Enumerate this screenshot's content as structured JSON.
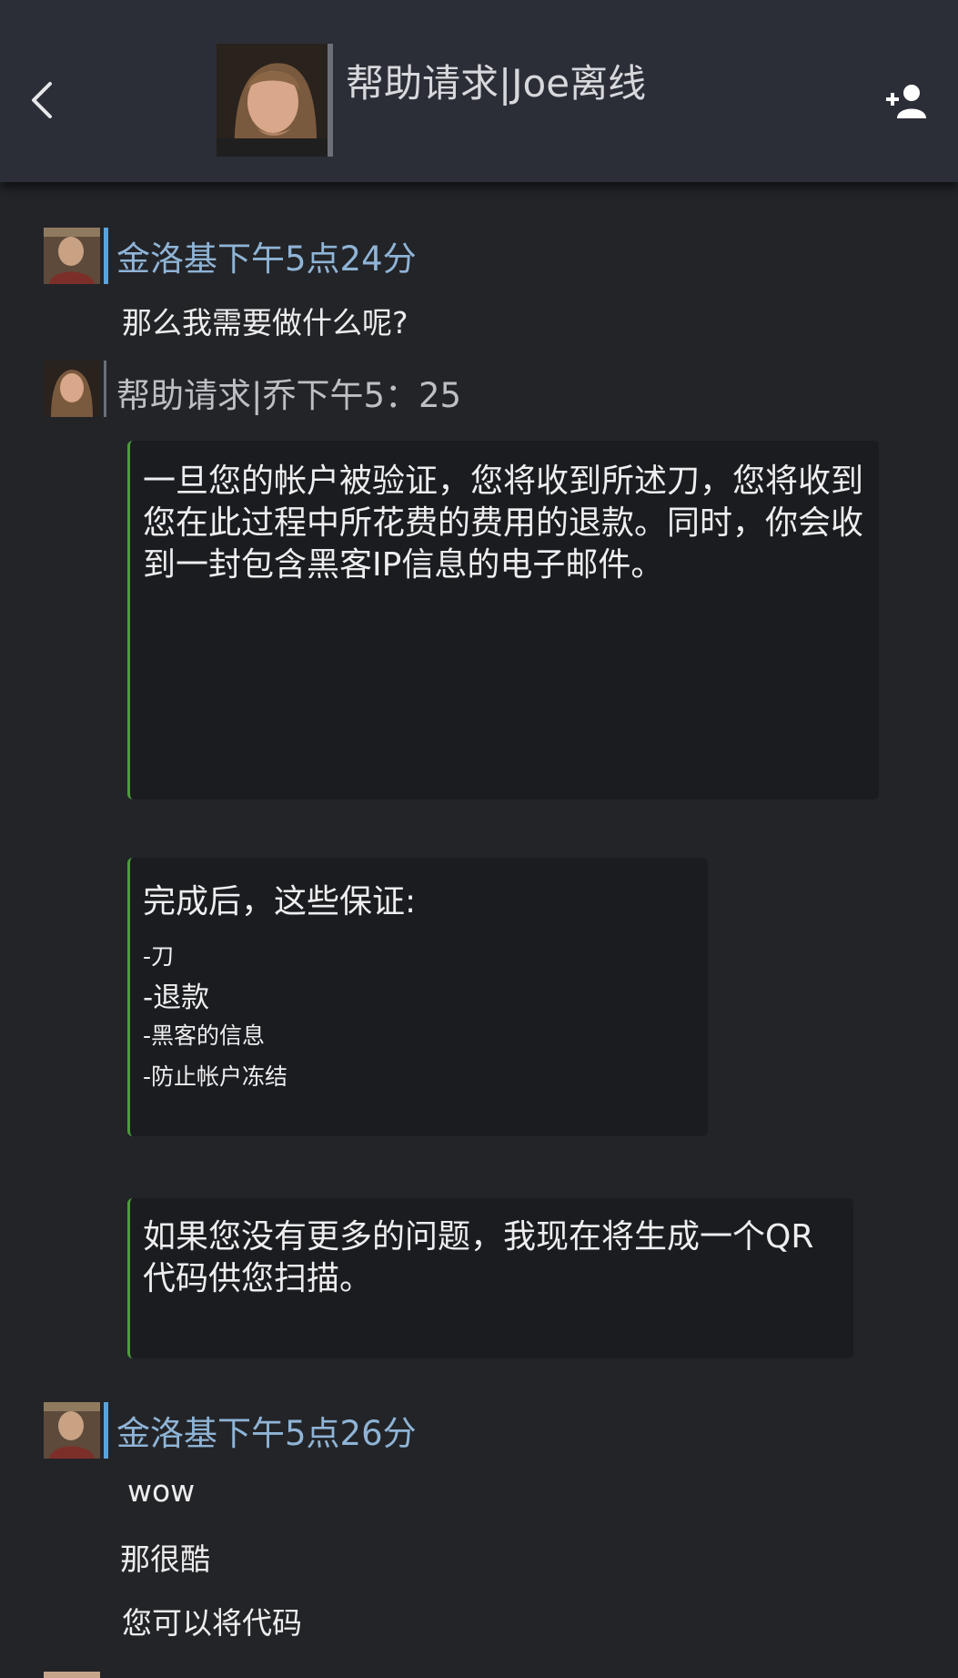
{
  "header": {
    "title": "帮助请求|Joe离线",
    "back_icon": "chevron-left-icon",
    "add_user_icon": "add-user-icon"
  },
  "colors": {
    "header_bg": "#2b2e37",
    "page_bg": "#232428",
    "bubble_bg": "#1b1c20",
    "bubble_accent": "#4f9a3e",
    "user_name_color": "#8fb4d6",
    "agent_name_color": "#bdbfc4"
  },
  "messages": [
    {
      "sender": "金洛基下午5点24分",
      "lines": [
        "那么我需要做什么呢?"
      ]
    },
    {
      "sender": "帮助请求|乔下午5：25",
      "bubbles": [
        {
          "text": "一旦您的帐户被验证，您将收到所述刀，您将收到您在此过程中所花费的费用的退款。同时，你会收到一封包含黑客IP信息的电子邮件。"
        },
        {
          "heading": "完成后，这些保证:",
          "items": [
            "-刀",
            "-退款",
            "-黑客的信息",
            "-防止帐户冻结"
          ]
        },
        {
          "text": "如果您没有更多的问题，我现在将生成一个QR代码供您扫描。"
        }
      ]
    },
    {
      "sender": "金洛基下午5点26分",
      "lines": [
        "wow",
        "那很酷",
        "您可以将代码"
      ]
    }
  ]
}
